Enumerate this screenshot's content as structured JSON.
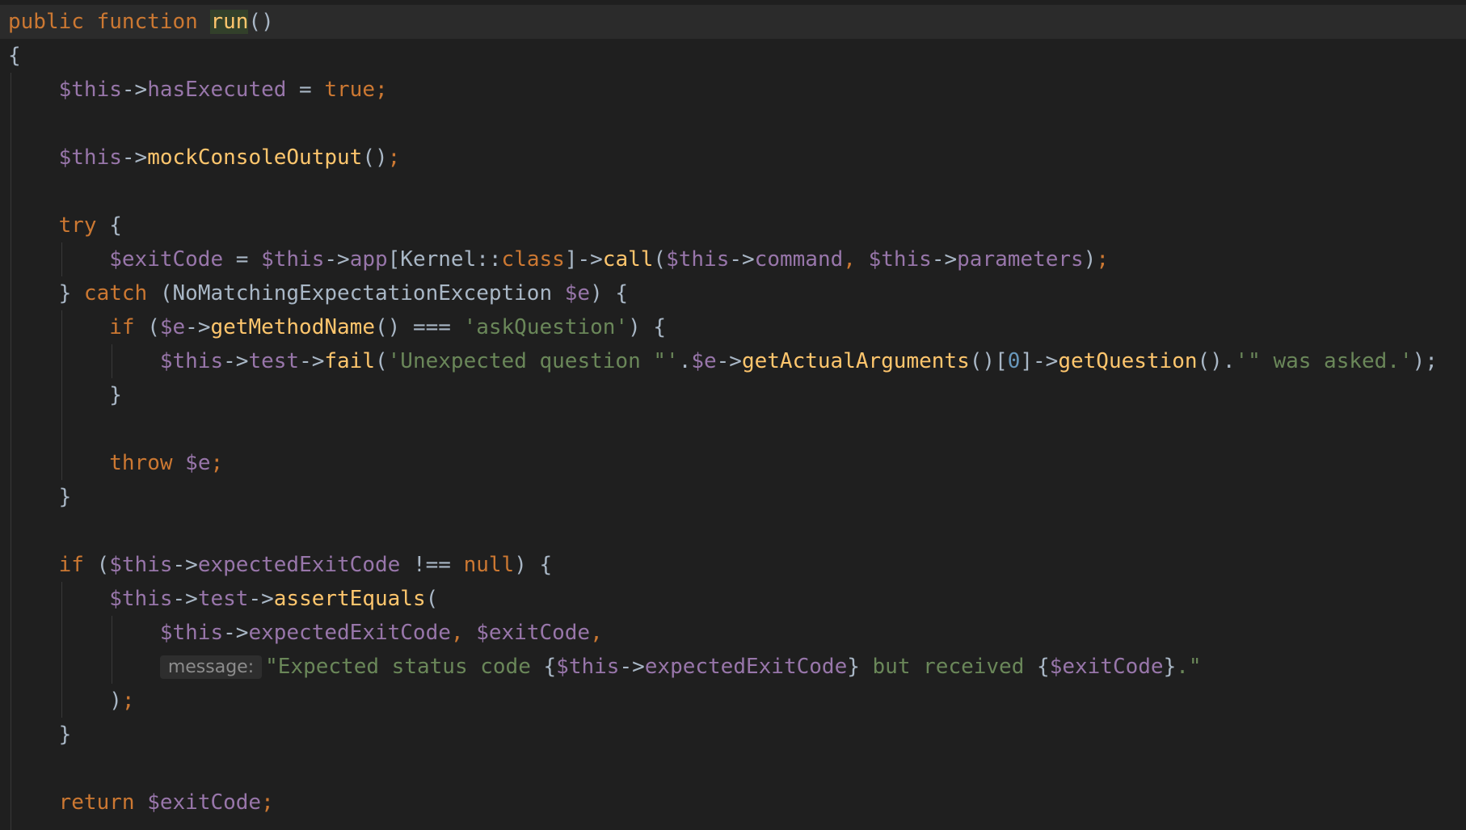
{
  "editor": {
    "language": "php",
    "colors": {
      "background": "#1f1f1f",
      "current_line": "#2b2b2b",
      "keyword": "#cc7832",
      "variable": "#9876aa",
      "function": "#ffc66d",
      "string": "#6a8759",
      "number": "#6897bb",
      "default": "#a9b7c6",
      "hint": "#8c8c8c"
    },
    "lines": [
      {
        "tokens": [
          {
            "t": "public function ",
            "k": "kw"
          },
          {
            "t": "run",
            "k": "hl"
          },
          {
            "t": "()",
            "k": "pun"
          }
        ]
      },
      {
        "tokens": [
          {
            "t": "{",
            "k": "pun"
          }
        ]
      },
      {
        "tokens": [
          {
            "t": "    ",
            "k": "def"
          },
          {
            "t": "$this",
            "k": "var"
          },
          {
            "t": "->",
            "k": "def"
          },
          {
            "t": "hasExecuted",
            "k": "var"
          },
          {
            "t": " = ",
            "k": "def"
          },
          {
            "t": "true",
            "k": "kw"
          },
          {
            "t": ";",
            "k": "kw"
          }
        ]
      },
      {
        "tokens": []
      },
      {
        "tokens": [
          {
            "t": "    ",
            "k": "def"
          },
          {
            "t": "$this",
            "k": "var"
          },
          {
            "t": "->",
            "k": "def"
          },
          {
            "t": "mockConsoleOutput",
            "k": "fn"
          },
          {
            "t": "()",
            "k": "def"
          },
          {
            "t": ";",
            "k": "kw"
          }
        ]
      },
      {
        "tokens": []
      },
      {
        "tokens": [
          {
            "t": "    ",
            "k": "def"
          },
          {
            "t": "try",
            "k": "kw"
          },
          {
            "t": " {",
            "k": "def"
          }
        ]
      },
      {
        "tokens": [
          {
            "t": "        ",
            "k": "def"
          },
          {
            "t": "$exitCode",
            "k": "var"
          },
          {
            "t": " = ",
            "k": "def"
          },
          {
            "t": "$this",
            "k": "var"
          },
          {
            "t": "->",
            "k": "def"
          },
          {
            "t": "app",
            "k": "var"
          },
          {
            "t": "[Kernel::",
            "k": "def"
          },
          {
            "t": "class",
            "k": "kw"
          },
          {
            "t": "]->",
            "k": "def"
          },
          {
            "t": "call",
            "k": "fn"
          },
          {
            "t": "(",
            "k": "def"
          },
          {
            "t": "$this",
            "k": "var"
          },
          {
            "t": "->",
            "k": "def"
          },
          {
            "t": "command",
            "k": "var"
          },
          {
            "t": ", ",
            "k": "kw"
          },
          {
            "t": "$this",
            "k": "var"
          },
          {
            "t": "->",
            "k": "def"
          },
          {
            "t": "parameters",
            "k": "var"
          },
          {
            "t": ")",
            "k": "def"
          },
          {
            "t": ";",
            "k": "kw"
          }
        ]
      },
      {
        "tokens": [
          {
            "t": "    } ",
            "k": "def"
          },
          {
            "t": "catch",
            "k": "kw"
          },
          {
            "t": " (NoMatchingExpectationException ",
            "k": "def"
          },
          {
            "t": "$e",
            "k": "var"
          },
          {
            "t": ") {",
            "k": "def"
          }
        ]
      },
      {
        "tokens": [
          {
            "t": "        ",
            "k": "def"
          },
          {
            "t": "if",
            "k": "kw"
          },
          {
            "t": " (",
            "k": "def"
          },
          {
            "t": "$e",
            "k": "var"
          },
          {
            "t": "->",
            "k": "def"
          },
          {
            "t": "getMethodName",
            "k": "fn"
          },
          {
            "t": "() === ",
            "k": "def"
          },
          {
            "t": "'askQuestion'",
            "k": "str"
          },
          {
            "t": ") {",
            "k": "def"
          }
        ]
      },
      {
        "tokens": [
          {
            "t": "            ",
            "k": "def"
          },
          {
            "t": "$this",
            "k": "var"
          },
          {
            "t": "->",
            "k": "def"
          },
          {
            "t": "test",
            "k": "var"
          },
          {
            "t": "->",
            "k": "def"
          },
          {
            "t": "fail",
            "k": "fn"
          },
          {
            "t": "(",
            "k": "def"
          },
          {
            "t": "'Unexpected question \"'",
            "k": "str"
          },
          {
            "t": ".",
            "k": "def"
          },
          {
            "t": "$e",
            "k": "var"
          },
          {
            "t": "->",
            "k": "def"
          },
          {
            "t": "getActualArguments",
            "k": "fn"
          },
          {
            "t": "()[",
            "k": "def"
          },
          {
            "t": "0",
            "k": "num"
          },
          {
            "t": "]->",
            "k": "def"
          },
          {
            "t": "getQuestion",
            "k": "fn"
          },
          {
            "t": "().",
            "k": "def"
          },
          {
            "t": "'\" was asked.'",
            "k": "str"
          },
          {
            "t": ");",
            "k": "def"
          }
        ]
      },
      {
        "tokens": [
          {
            "t": "        }",
            "k": "def"
          }
        ]
      },
      {
        "tokens": []
      },
      {
        "tokens": [
          {
            "t": "        ",
            "k": "def"
          },
          {
            "t": "throw",
            "k": "kw"
          },
          {
            "t": " ",
            "k": "def"
          },
          {
            "t": "$e",
            "k": "var"
          },
          {
            "t": ";",
            "k": "kw"
          }
        ]
      },
      {
        "tokens": [
          {
            "t": "    }",
            "k": "def"
          }
        ]
      },
      {
        "tokens": []
      },
      {
        "tokens": [
          {
            "t": "    ",
            "k": "def"
          },
          {
            "t": "if",
            "k": "kw"
          },
          {
            "t": " (",
            "k": "def"
          },
          {
            "t": "$this",
            "k": "var"
          },
          {
            "t": "->",
            "k": "def"
          },
          {
            "t": "expectedExitCode",
            "k": "var"
          },
          {
            "t": " !== ",
            "k": "def"
          },
          {
            "t": "null",
            "k": "kw"
          },
          {
            "t": ") {",
            "k": "def"
          }
        ]
      },
      {
        "tokens": [
          {
            "t": "        ",
            "k": "def"
          },
          {
            "t": "$this",
            "k": "var"
          },
          {
            "t": "->",
            "k": "def"
          },
          {
            "t": "test",
            "k": "var"
          },
          {
            "t": "->",
            "k": "def"
          },
          {
            "t": "assertEquals",
            "k": "fn"
          },
          {
            "t": "(",
            "k": "def"
          }
        ]
      },
      {
        "tokens": [
          {
            "t": "            ",
            "k": "def"
          },
          {
            "t": "$this",
            "k": "var"
          },
          {
            "t": "->",
            "k": "def"
          },
          {
            "t": "expectedExitCode",
            "k": "var"
          },
          {
            "t": ", ",
            "k": "kw"
          },
          {
            "t": "$exitCode",
            "k": "var"
          },
          {
            "t": ",",
            "k": "kw"
          }
        ]
      },
      {
        "tokens": [
          {
            "t": "            ",
            "k": "def"
          },
          {
            "t": "message:",
            "k": "hint"
          },
          {
            "t": "\"Expected status code ",
            "k": "str"
          },
          {
            "t": "{",
            "k": "def"
          },
          {
            "t": "$this",
            "k": "var"
          },
          {
            "t": "->",
            "k": "def"
          },
          {
            "t": "expectedExitCode",
            "k": "var"
          },
          {
            "t": "}",
            "k": "def"
          },
          {
            "t": " but received ",
            "k": "str"
          },
          {
            "t": "{",
            "k": "def"
          },
          {
            "t": "$exitCode",
            "k": "var"
          },
          {
            "t": "}",
            "k": "def"
          },
          {
            "t": ".\"",
            "k": "str"
          }
        ]
      },
      {
        "tokens": [
          {
            "t": "        )",
            "k": "def"
          },
          {
            "t": ";",
            "k": "kw"
          }
        ]
      },
      {
        "tokens": [
          {
            "t": "    }",
            "k": "def"
          }
        ]
      },
      {
        "tokens": []
      },
      {
        "tokens": [
          {
            "t": "    ",
            "k": "def"
          },
          {
            "t": "return",
            "k": "kw"
          },
          {
            "t": " ",
            "k": "def"
          },
          {
            "t": "$exitCode",
            "k": "var"
          },
          {
            "t": ";",
            "k": "kw"
          }
        ]
      }
    ]
  }
}
